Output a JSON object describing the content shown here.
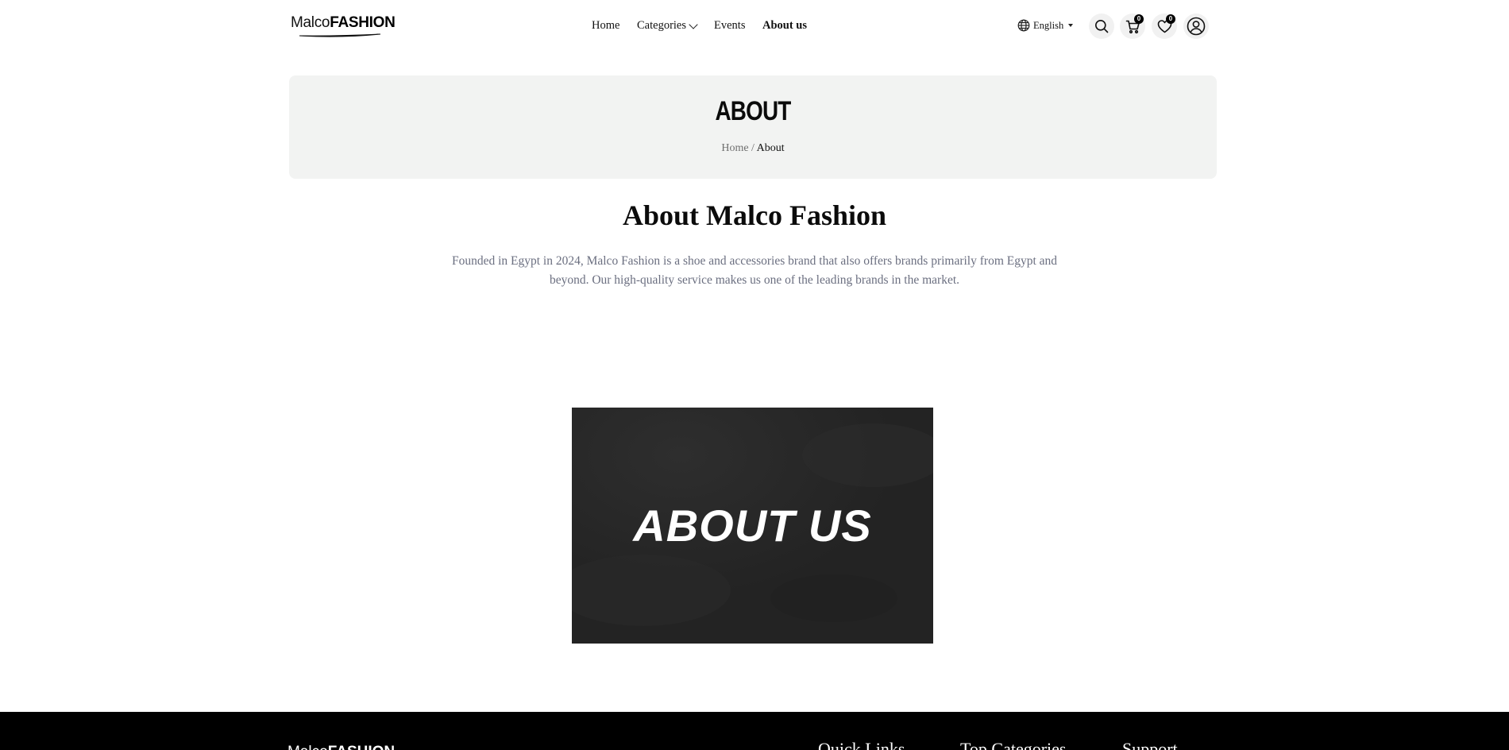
{
  "header": {
    "logo": {
      "part1": "Malco",
      "part2": "FASHION"
    },
    "nav": [
      {
        "label": "Home"
      },
      {
        "label": "Categories"
      },
      {
        "label": "Events"
      },
      {
        "label": "About us"
      }
    ],
    "language": "English",
    "cart_count": "0",
    "wishlist_count": "0"
  },
  "banner": {
    "title": "ABOUT",
    "breadcrumb": {
      "home": "Home",
      "separator": "/",
      "current": "About"
    }
  },
  "main": {
    "title": "About Malco Fashion",
    "description": "Founded in Egypt in 2024, Malco Fashion is a shoe and accessories brand that also offers brands primarily from Egypt and beyond. Our high-quality service makes us one of the leading brands in the market.",
    "image_text": "ABOUT US"
  },
  "footer": {
    "logo": {
      "part1": "Malco",
      "part2": "FASHION"
    },
    "headings": [
      "Quick Links",
      "Top Categories",
      "Support"
    ]
  },
  "colors": {
    "accent": "#000000",
    "banner_bg": "#f2f3f2",
    "desc_text": "#6b6f80",
    "image_bg": "#262626"
  }
}
